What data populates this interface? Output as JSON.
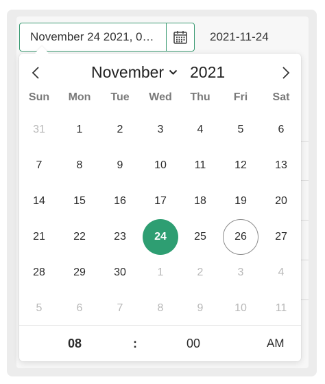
{
  "input": {
    "display_value": "November 24 2021, 0…",
    "iso_value": "2021-11-24"
  },
  "calendar": {
    "month": "November",
    "year": "2021",
    "weekdays": [
      "Sun",
      "Mon",
      "Tue",
      "Wed",
      "Thu",
      "Fri",
      "Sat"
    ],
    "weeks": [
      [
        {
          "d": "31",
          "muted": true
        },
        {
          "d": "1"
        },
        {
          "d": "2"
        },
        {
          "d": "3"
        },
        {
          "d": "4"
        },
        {
          "d": "5"
        },
        {
          "d": "6"
        }
      ],
      [
        {
          "d": "7"
        },
        {
          "d": "8"
        },
        {
          "d": "9"
        },
        {
          "d": "10"
        },
        {
          "d": "11"
        },
        {
          "d": "12"
        },
        {
          "d": "13"
        }
      ],
      [
        {
          "d": "14"
        },
        {
          "d": "15"
        },
        {
          "d": "16"
        },
        {
          "d": "17"
        },
        {
          "d": "18"
        },
        {
          "d": "19"
        },
        {
          "d": "20"
        }
      ],
      [
        {
          "d": "21"
        },
        {
          "d": "22"
        },
        {
          "d": "23"
        },
        {
          "d": "24",
          "selected": true
        },
        {
          "d": "25"
        },
        {
          "d": "26",
          "today": true
        },
        {
          "d": "27"
        }
      ],
      [
        {
          "d": "28"
        },
        {
          "d": "29"
        },
        {
          "d": "30"
        },
        {
          "d": "1",
          "muted": true
        },
        {
          "d": "2",
          "muted": true
        },
        {
          "d": "3",
          "muted": true
        },
        {
          "d": "4",
          "muted": true
        }
      ],
      [
        {
          "d": "5",
          "muted": true
        },
        {
          "d": "6",
          "muted": true
        },
        {
          "d": "7",
          "muted": true
        },
        {
          "d": "8",
          "muted": true
        },
        {
          "d": "9",
          "muted": true
        },
        {
          "d": "10",
          "muted": true
        },
        {
          "d": "11",
          "muted": true
        }
      ]
    ]
  },
  "time": {
    "hour": "08",
    "separator": ":",
    "minute": "00",
    "ampm": "AM"
  },
  "icons": {
    "calendar": "calendar-icon",
    "prev": "chevron-left-icon",
    "next": "chevron-right-icon",
    "month_dropdown": "chevron-down-icon"
  },
  "colors": {
    "accent": "#2e9e72",
    "border_accent": "#3a9a72",
    "muted_text": "#b8b8b8",
    "weekday_text": "#7a7a7a"
  }
}
